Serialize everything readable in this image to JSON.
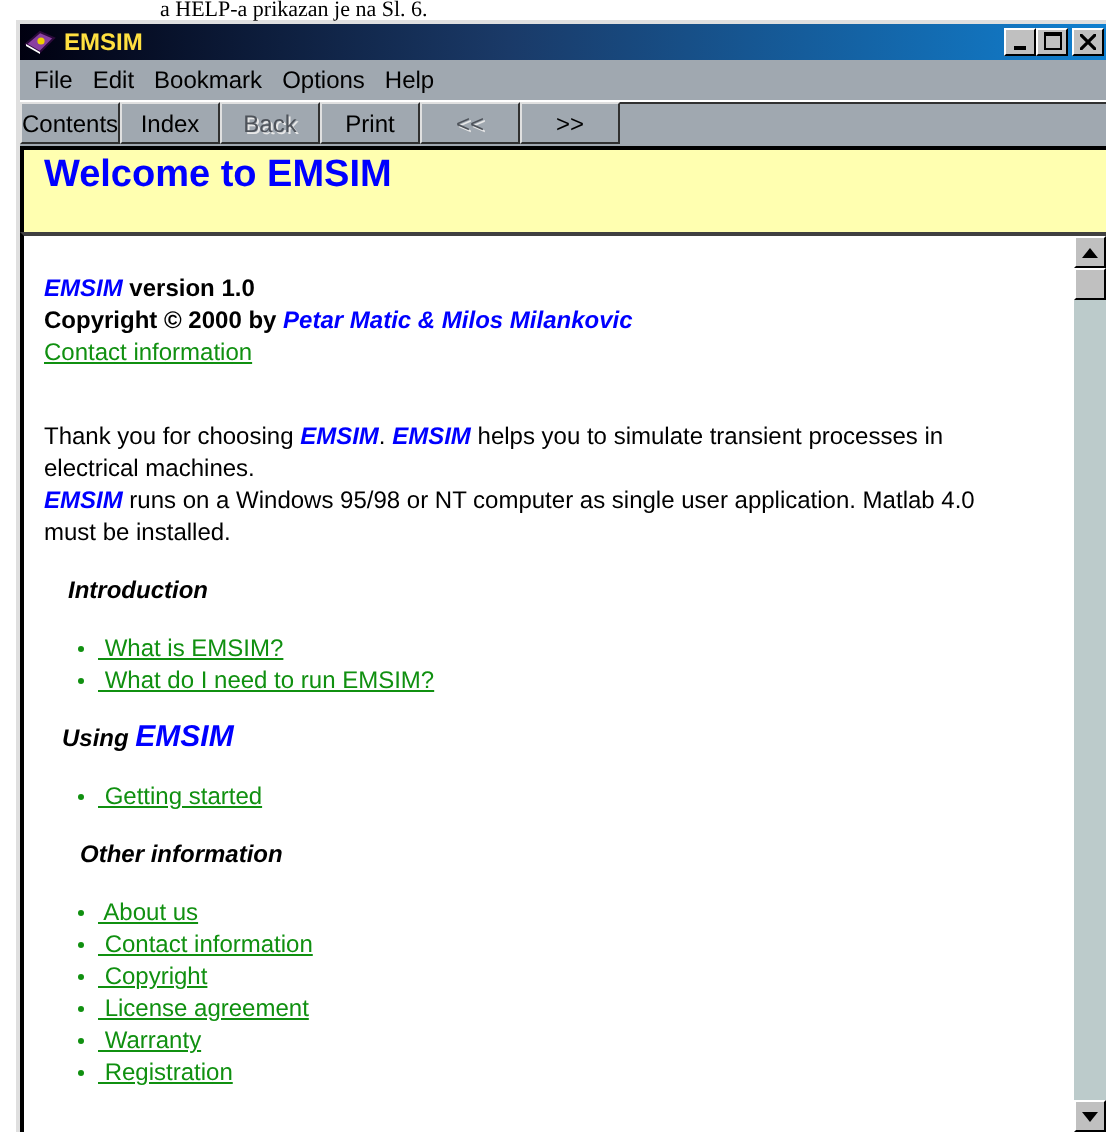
{
  "document_text": "a HELP-a prikazan je na Sl. 6.",
  "window": {
    "title": "EMSIM"
  },
  "menu": [
    {
      "label": "File"
    },
    {
      "label": "Edit"
    },
    {
      "label": "Bookmark"
    },
    {
      "label": "Options"
    },
    {
      "label": "Help"
    }
  ],
  "toolbar": [
    {
      "label": "Contents",
      "disabled": false
    },
    {
      "label": "Index",
      "disabled": false
    },
    {
      "label": "Back",
      "disabled": true
    },
    {
      "label": "Print",
      "disabled": false
    },
    {
      "label": "<<",
      "disabled": true
    },
    {
      "label": ">>",
      "disabled": false
    }
  ],
  "header": {
    "title": "Welcome to EMSIM"
  },
  "content": [
    {
      "kind": "lines",
      "runs": [
        [
          {
            "kind": "brand",
            "text": "EMSIM"
          },
          {
            "kind": "text",
            "text": " version 1.0"
          }
        ],
        [
          {
            "kind": "text",
            "text": "Copyright © 2000 by "
          },
          {
            "kind": "brand",
            "text": "Petar Matic & Milos Milankovic"
          }
        ]
      ]
    },
    {
      "kind": "link",
      "text": "Contact information"
    },
    {
      "kind": "para",
      "runs": [
        {
          "kind": "text",
          "text": "Thank you for choosing "
        },
        {
          "kind": "brand",
          "text": "EMSIM"
        },
        {
          "kind": "text",
          "text": ". "
        },
        {
          "kind": "brand",
          "text": "EMSIM"
        },
        {
          "kind": "text",
          "text": " helps you to simulate transient processes in electrical machines."
        }
      ]
    },
    {
      "kind": "para",
      "runs": [
        {
          "kind": "brand",
          "text": "EMSIM"
        },
        {
          "kind": "text",
          "text": " runs on a Windows 95/98 or NT computer as single user application. Matlab 4.0 must be installed."
        }
      ]
    },
    {
      "kind": "heading",
      "runs": [
        {
          "kind": "text",
          "text": "Introduction"
        }
      ]
    },
    {
      "kind": "list",
      "items": [
        " What is EMSIM?",
        " What do I need to run EMSIM?"
      ]
    },
    {
      "kind": "heading2",
      "runs": [
        {
          "kind": "text",
          "text": "Using "
        },
        {
          "kind": "brand",
          "text": "EMSIM"
        }
      ]
    },
    {
      "kind": "list",
      "items": [
        " Getting started"
      ]
    },
    {
      "kind": "heading3",
      "runs": [
        {
          "kind": "text",
          "text": "Other information"
        }
      ]
    },
    {
      "kind": "list",
      "items": [
        " About us",
        " Contact information",
        " Copyright",
        " License agreement",
        " Warranty",
        " Registration"
      ]
    }
  ]
}
